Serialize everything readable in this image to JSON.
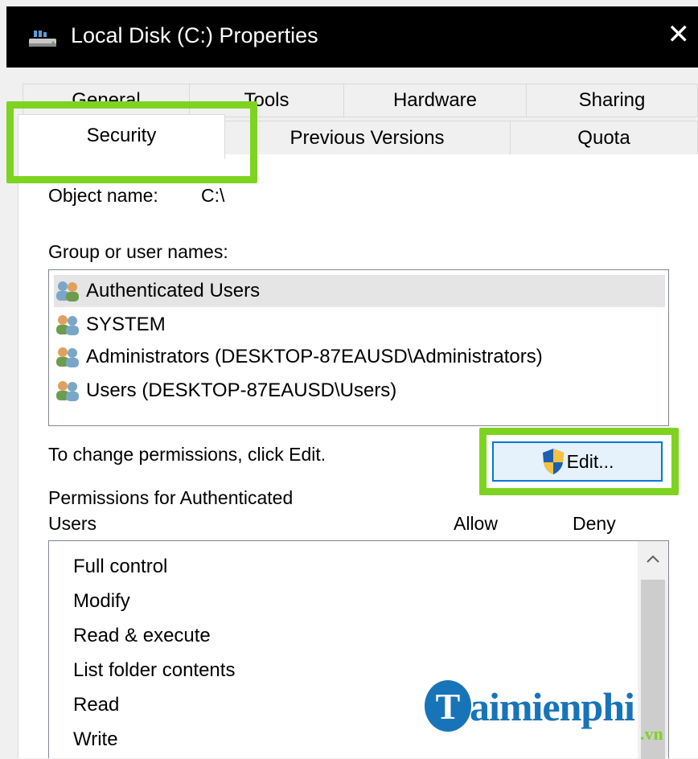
{
  "window": {
    "title": "Local Disk (C:) Properties",
    "close_glyph": "✕",
    "icon": "drive-icon"
  },
  "tabs": {
    "row1": [
      "General",
      "Tools",
      "Hardware",
      "Sharing"
    ],
    "row2": [
      "Security",
      "Previous Versions",
      "Quota"
    ],
    "active": "Security"
  },
  "security": {
    "object_name_label": "Object name:",
    "object_name_value": "C:\\",
    "group_label": "Group or user names:",
    "users": [
      {
        "name": "Authenticated Users",
        "selected": true
      },
      {
        "name": "SYSTEM",
        "selected": false
      },
      {
        "name": "Administrators (DESKTOP-87EAUSD\\Administrators)",
        "selected": false
      },
      {
        "name": "Users (DESKTOP-87EAUSD\\Users)",
        "selected": false
      }
    ],
    "change_hint": "To change permissions, click Edit.",
    "edit_button": "Edit...",
    "permissions_for_line1": "Permissions for Authenticated",
    "permissions_for_line2": "Users",
    "allow_header": "Allow",
    "deny_header": "Deny",
    "permissions": [
      "Full control",
      "Modify",
      "Read & execute",
      "List folder contents",
      "Read",
      "Write"
    ]
  },
  "highlight_color": "#7ed321",
  "accent_color": "#0078d7",
  "watermark": {
    "logo_letter": "T",
    "text": "aimienphi",
    "suffix": ".vn"
  }
}
